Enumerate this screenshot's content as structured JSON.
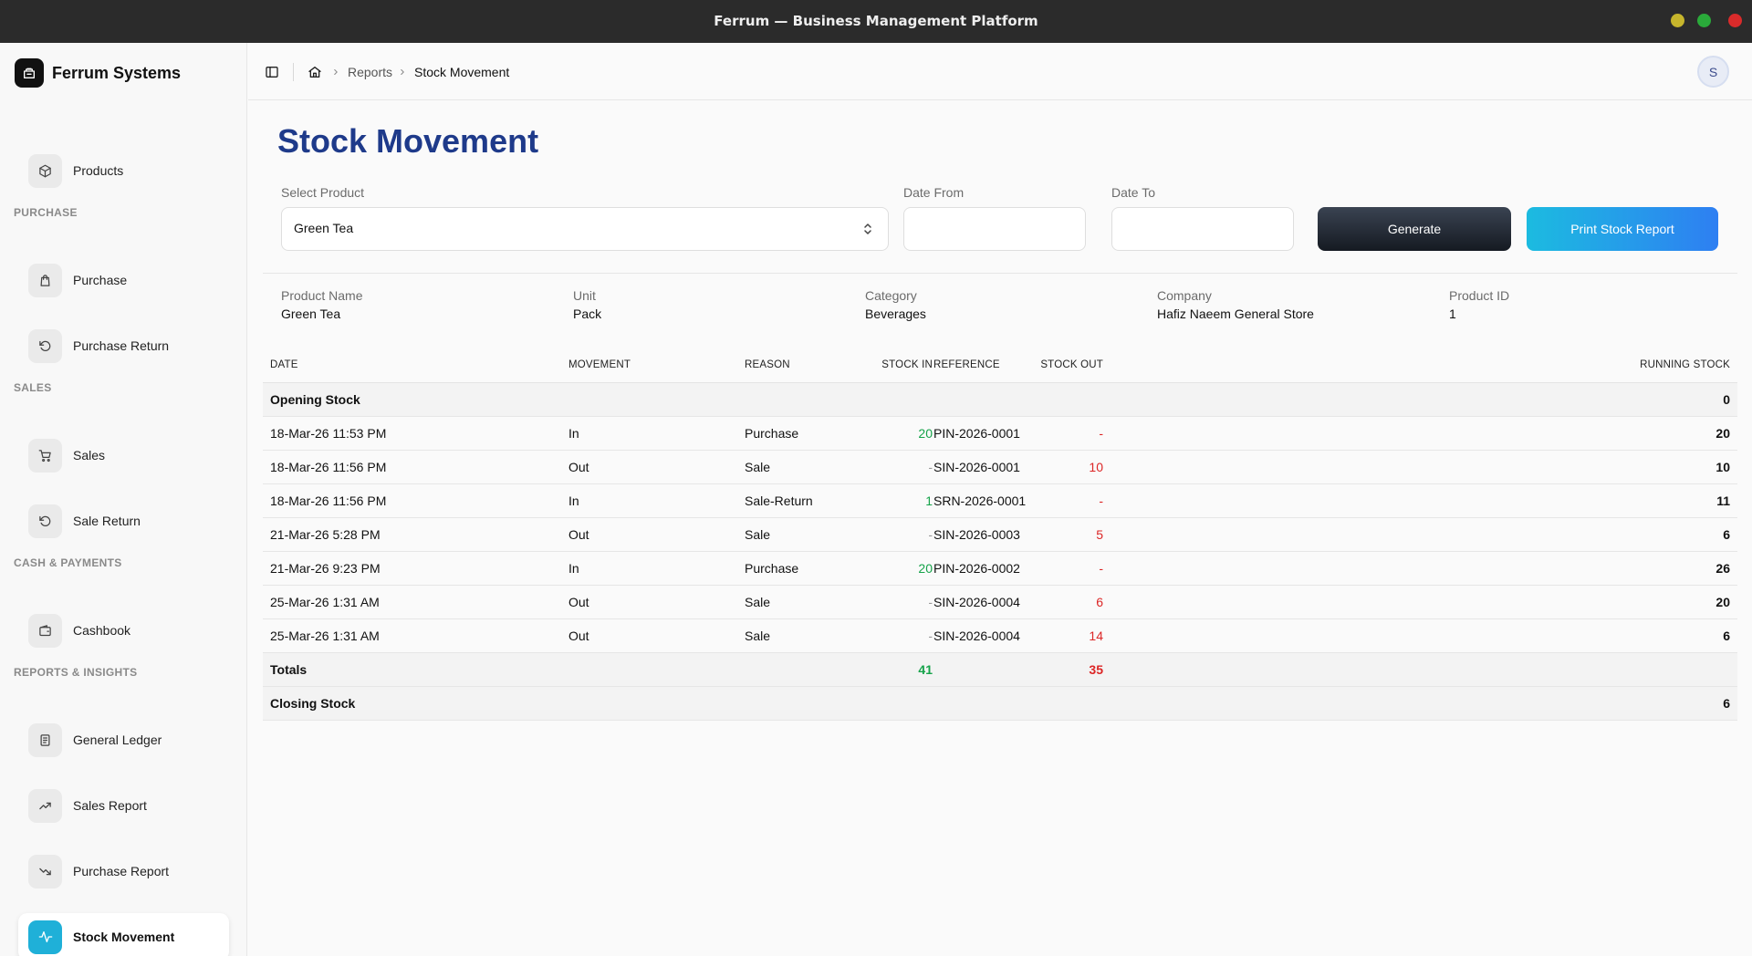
{
  "window": {
    "title": "Ferrum — Business Management Platform",
    "colors": {
      "minimize": "#c6b52c",
      "maximize": "#2aaa3a",
      "close": "#d92b2b"
    }
  },
  "brand": {
    "name": "Ferrum Systems",
    "icon": "store-icon"
  },
  "sidebar": {
    "top_item": {
      "label": "Products",
      "icon": "box-icon"
    },
    "sections": [
      {
        "title": "PURCHASE",
        "items": [
          {
            "label": "Purchase",
            "icon": "shopping-bag-icon"
          },
          {
            "label": "Purchase Return",
            "icon": "rotate-ccw-icon"
          }
        ]
      },
      {
        "title": "SALES",
        "items": [
          {
            "label": "Sales",
            "icon": "cart-icon"
          },
          {
            "label": "Sale Return",
            "icon": "rotate-ccw-icon"
          }
        ]
      },
      {
        "title": "CASH & PAYMENTS",
        "items": [
          {
            "label": "Cashbook",
            "icon": "wallet-icon"
          }
        ]
      },
      {
        "title": "REPORTS & INSIGHTS",
        "items": [
          {
            "label": "General Ledger",
            "icon": "document-icon"
          },
          {
            "label": "Sales Report",
            "icon": "trending-up-icon"
          },
          {
            "label": "Purchase Report",
            "icon": "trending-down-icon"
          },
          {
            "label": "Stock Movement",
            "icon": "activity-icon",
            "active": true
          }
        ]
      }
    ],
    "accent": "#1fb0d8"
  },
  "header": {
    "breadcrumb": [
      "Reports",
      "Stock Movement"
    ],
    "user_initial": "S"
  },
  "page": {
    "title": "Stock Movement",
    "title_color": "#1e3a8a"
  },
  "filters": {
    "product_label": "Select Product",
    "product_value": "Green Tea",
    "date_from_label": "Date From",
    "date_from_value": "",
    "date_to_label": "Date To",
    "date_to_value": "",
    "generate_label": "Generate",
    "print_label": "Print Stock Report"
  },
  "product_info": [
    {
      "label": "Product Name",
      "value": "Green Tea"
    },
    {
      "label": "Unit",
      "value": "Pack"
    },
    {
      "label": "Category",
      "value": "Beverages"
    },
    {
      "label": "Company",
      "value": "Hafiz Naeem General Store"
    },
    {
      "label": "Product ID",
      "value": "1"
    }
  ],
  "table": {
    "columns": [
      "DATE",
      "MOVEMENT",
      "REASON",
      "REFERENCE",
      "STOCK IN",
      "STOCK OUT",
      "RUNNING STOCK"
    ],
    "opening": {
      "label": "Opening Stock",
      "value": "0"
    },
    "rows": [
      {
        "date": "18-Mar-26 11:53 PM",
        "movement": "In",
        "reason": "Purchase",
        "reference": "PIN-2026-0001",
        "stock_in": "20",
        "stock_out": "-",
        "running": "20"
      },
      {
        "date": "18-Mar-26 11:56 PM",
        "movement": "Out",
        "reason": "Sale",
        "reference": "SIN-2026-0001",
        "stock_in": "-",
        "stock_out": "10",
        "running": "10"
      },
      {
        "date": "18-Mar-26 11:56 PM",
        "movement": "In",
        "reason": "Sale-Return",
        "reference": "SRN-2026-0001",
        "stock_in": "1",
        "stock_out": "-",
        "running": "11"
      },
      {
        "date": "21-Mar-26 5:28 PM",
        "movement": "Out",
        "reason": "Sale",
        "reference": "SIN-2026-0003",
        "stock_in": "-",
        "stock_out": "5",
        "running": "6"
      },
      {
        "date": "21-Mar-26 9:23 PM",
        "movement": "In",
        "reason": "Purchase",
        "reference": "PIN-2026-0002",
        "stock_in": "20",
        "stock_out": "-",
        "running": "26"
      },
      {
        "date": "25-Mar-26 1:31 AM",
        "movement": "Out",
        "reason": "Sale",
        "reference": "SIN-2026-0004",
        "stock_in": "-",
        "stock_out": "6",
        "running": "20"
      },
      {
        "date": "25-Mar-26 1:31 AM",
        "movement": "Out",
        "reason": "Sale",
        "reference": "SIN-2026-0004",
        "stock_in": "-",
        "stock_out": "14",
        "running": "6"
      }
    ],
    "totals": {
      "label": "Totals",
      "stock_in": "41",
      "stock_out": "35"
    },
    "closing": {
      "label": "Closing Stock",
      "value": "6"
    },
    "colors": {
      "in": "#16a34a",
      "out": "#dc2626"
    }
  }
}
